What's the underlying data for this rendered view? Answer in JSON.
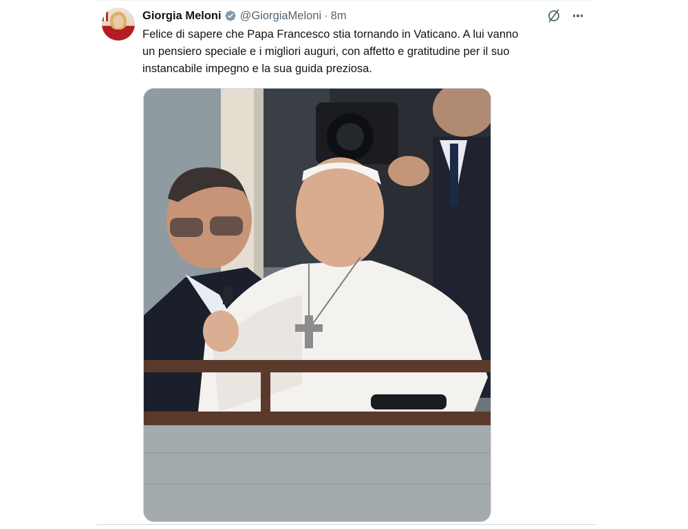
{
  "tweet": {
    "author_name": "Giorgia Meloni",
    "handle": "@GiorgiaMeloni",
    "separator": "·",
    "time": "8m",
    "text_lines": [
      "Felice di sapere che Papa Francesco stia tornando in Vaticano. A lui vanno",
      "un pensiero speciale e i migliori auguri, con affetto e gratitudine per il suo",
      "instancabile impegno e la sua guida preziosa."
    ]
  },
  "icons": {
    "verified": "verified-badge-icon",
    "grok": "grok-icon",
    "more": "more-options-icon"
  },
  "colors": {
    "verified_badge": "#829aab",
    "secondary_text": "#536471",
    "primary_text": "#0f1419"
  }
}
